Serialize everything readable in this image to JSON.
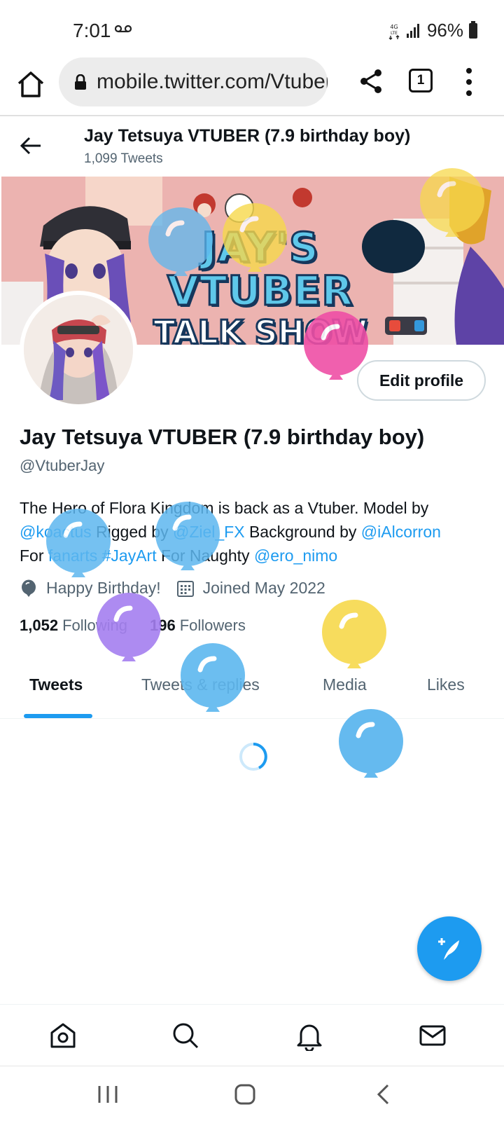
{
  "status_bar": {
    "time": "7:01",
    "battery": "96%"
  },
  "browser": {
    "url": "mobile.twitter.com/VtuberJay",
    "tab_count": "1"
  },
  "header": {
    "name": "Jay Tetsuya VTUBER (7.9 birthday boy)",
    "tweet_count": "1,099 Tweets"
  },
  "banner": {
    "line1": "JAY'S VTUBER",
    "line2": "TALK SHOW"
  },
  "profile": {
    "edit_label": "Edit profile",
    "name": "Jay Tetsuya VTUBER (7.9 birthday boy)",
    "handle": "@VtuberJay",
    "bio": {
      "t1": "The Hero of Flora Kingdom is back as a Vtuber. Model by",
      "l1": "@koactus",
      "t2": " Rigged by ",
      "l2": "@Ziel_FX",
      "t3": " Background by ",
      "l3": "@iAlcorron",
      "t4": "For ",
      "l4": "fanarts",
      "t5": " ",
      "l5": "#JayArt",
      "t6": " For Naughty ",
      "l6": "@ero_nimo"
    },
    "birthday": "Happy Birthday!",
    "joined": "Joined May 2022",
    "following_count": "1,052",
    "following_label": "Following",
    "followers_count": "196",
    "followers_label": "Followers"
  },
  "tabs": [
    "Tweets",
    "Tweets & replies",
    "Media",
    "Likes"
  ],
  "colors": {
    "accent": "#1d9bf0",
    "balloon_blue": "#5db7ef",
    "balloon_yellow": "#f7d94c",
    "balloon_pink": "#ef4fa6",
    "balloon_purple": "#a57ff0"
  },
  "icons": {
    "browser": [
      "home-icon",
      "lock-icon",
      "share-icon",
      "tabs-icon",
      "more-vertical-icon"
    ],
    "bottom_nav": [
      "home-icon",
      "search-icon",
      "bell-icon",
      "mail-icon"
    ],
    "android": [
      "recents-icon",
      "home-icon",
      "back-icon"
    ]
  }
}
